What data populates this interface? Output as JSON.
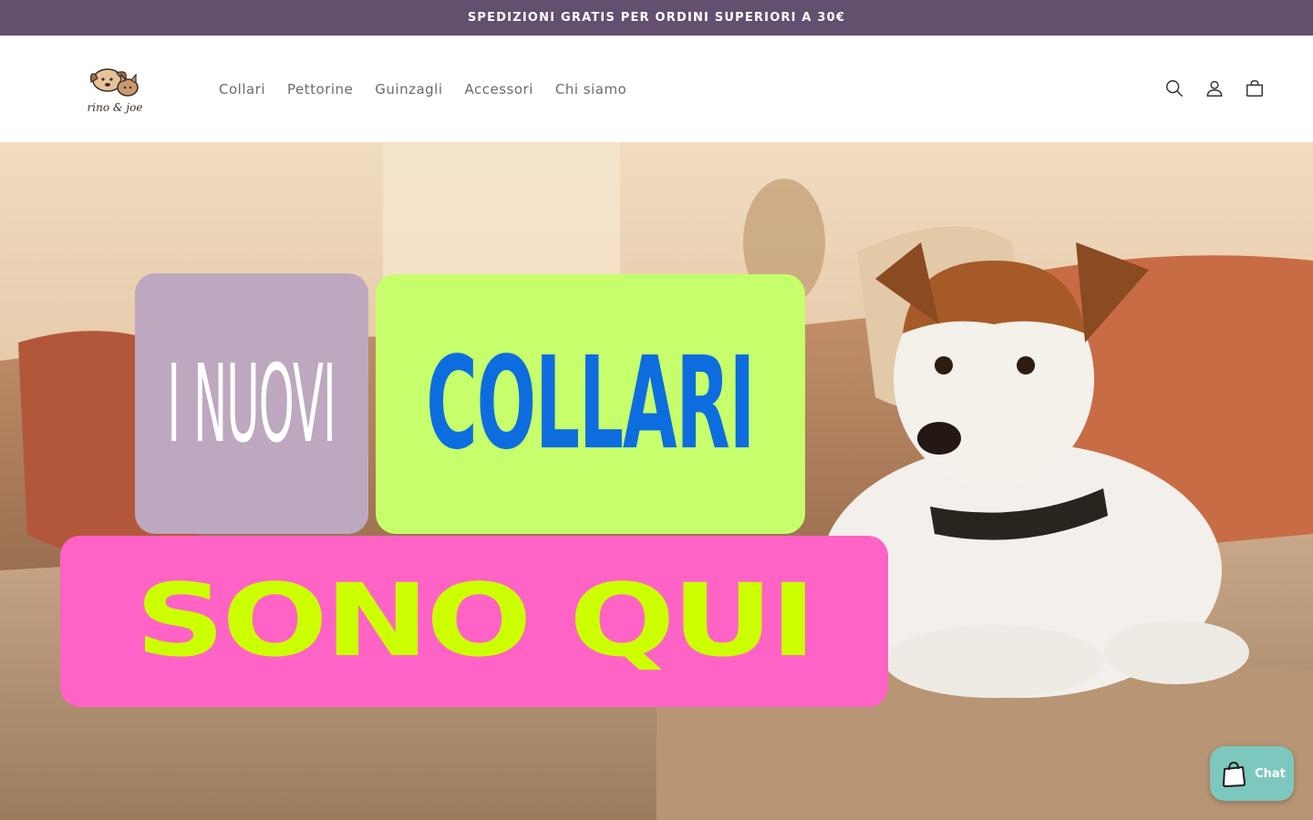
{
  "announcement": {
    "text": "SPEDIZIONI GRATIS PER ORDINI SUPERIORI A 30€"
  },
  "header": {
    "logo_text": "rino & joe",
    "nav": [
      {
        "label": "Collari"
      },
      {
        "label": "Pettorine"
      },
      {
        "label": "Guinzagli"
      },
      {
        "label": "Accessori"
      },
      {
        "label": "Chi siamo"
      }
    ],
    "icons": [
      "search-icon",
      "account-icon",
      "cart-icon"
    ]
  },
  "hero": {
    "line1": "I NUOVI",
    "line2": "COLLARI",
    "line3": "SONO QUI",
    "colors": {
      "tile1": "#bda8bf",
      "tile2": "#c6ff6b",
      "tile3": "#ff63c5",
      "collari_text": "#0d6ddf",
      "sono_text": "#ccff00"
    }
  },
  "chat": {
    "label": "Chat",
    "icon": "shopping-bag-icon",
    "color": "#7dc8be"
  },
  "theme": {
    "announcement_bg": "#634f6e"
  }
}
